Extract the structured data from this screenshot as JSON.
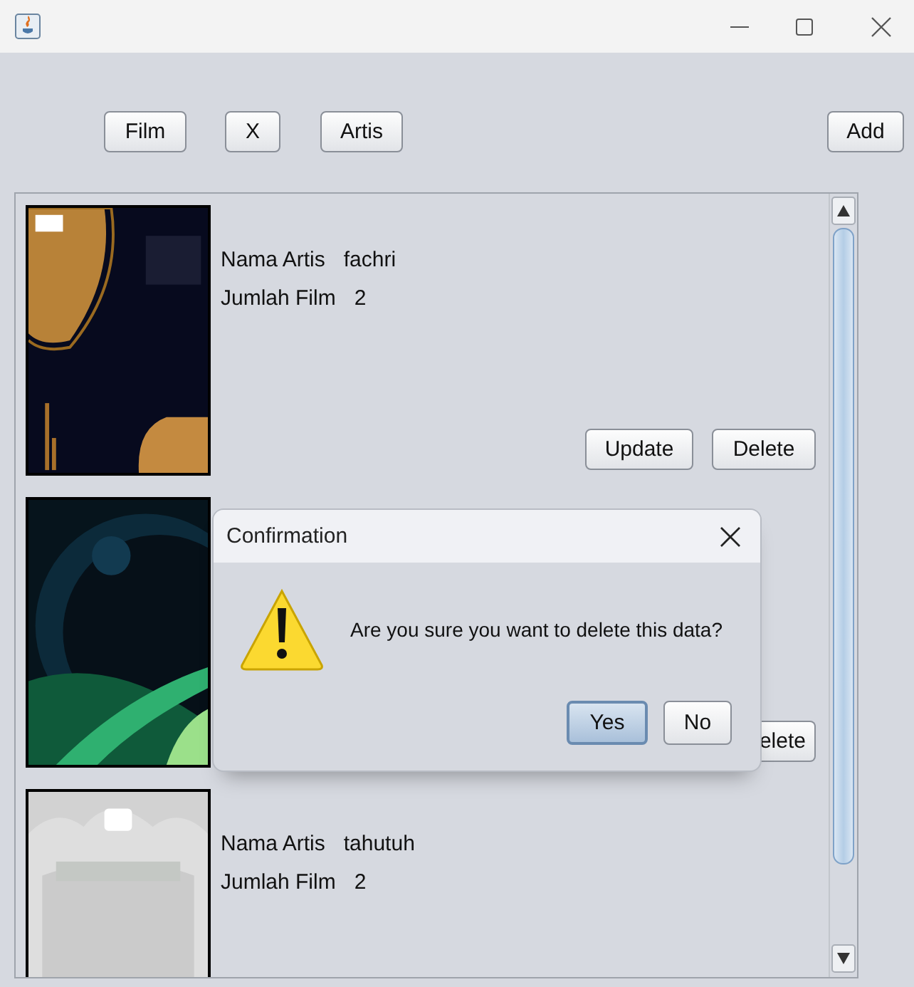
{
  "toolbar": {
    "buttons": [
      "Film",
      "X",
      "Artis"
    ],
    "add_button": "Add"
  },
  "artists": [
    {
      "name_label": "Nama Artis",
      "name": "fachri",
      "count_label": "Jumlah Film",
      "count": "2",
      "buttons": [
        "Update",
        "Delete"
      ]
    },
    {
      "buttons": [
        "elete"
      ]
    },
    {
      "name_label": "Nama Artis",
      "name": "tahutuh",
      "count_label": "Jumlah Film",
      "count": "2"
    }
  ],
  "dialog": {
    "title": "Confirmation",
    "message": "Are you sure you want to delete this data?",
    "buttons": [
      {
        "label": "Yes",
        "selected": true
      },
      {
        "label": "No",
        "selected": false
      }
    ]
  }
}
